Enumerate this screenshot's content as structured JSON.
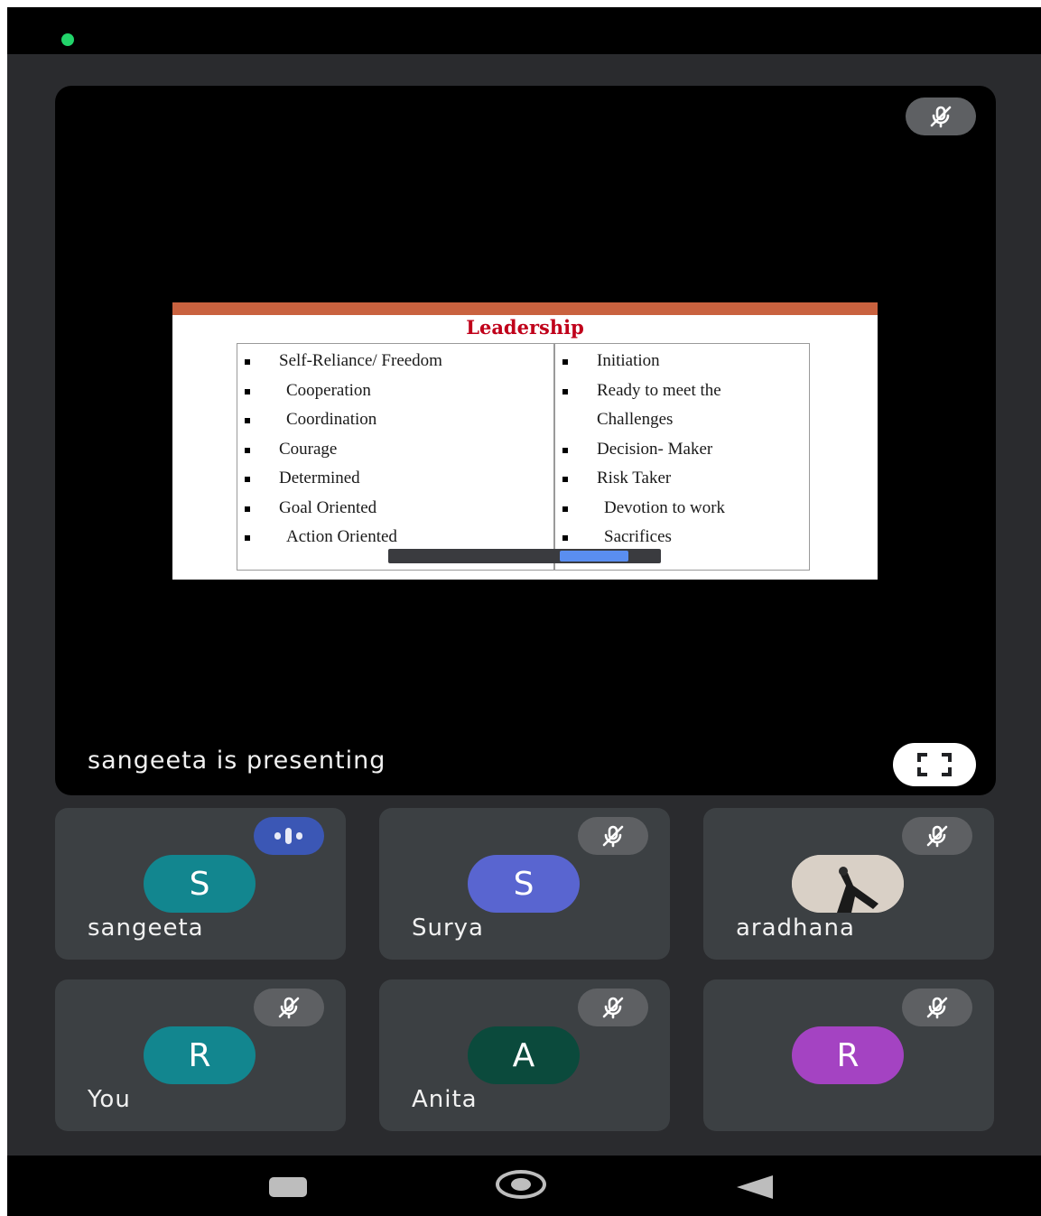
{
  "presentation": {
    "presenter_text": "sangeeta is presenting",
    "slide": {
      "title": "Leadership",
      "left_items": [
        "Self-Reliance/ Freedom",
        "Cooperation",
        "Coordination",
        "Courage",
        "Determined",
        "Goal Oriented",
        "Action Oriented"
      ],
      "right_items": [
        "Initiation",
        "Ready to meet the",
        "Challenges",
        "Decision- Maker",
        "Risk Taker",
        "Devotion to work",
        "Sacrifices"
      ]
    }
  },
  "participants": [
    {
      "name": "sangeeta",
      "initial": "S",
      "avatar_color": "#12868f",
      "status": "speaking"
    },
    {
      "name": "Surya",
      "initial": "S",
      "avatar_color": "#5965d0",
      "status": "muted"
    },
    {
      "name": "aradhana",
      "initial": "",
      "avatar_color": "#cfc6bd",
      "status": "muted",
      "avatar": "photo"
    },
    {
      "name": "You",
      "initial": "R",
      "avatar_color": "#12868f",
      "status": "muted"
    },
    {
      "name": "Anita",
      "initial": "A",
      "avatar_color": "#0b4a3c",
      "status": "muted"
    },
    {
      "name": "",
      "initial": "R",
      "avatar_color": "#a443c2",
      "status": "muted"
    }
  ],
  "icons": {
    "muted": "mic-off-icon",
    "speaking": "audio-level-icon",
    "fullscreen": "fullscreen-icon",
    "nav": [
      "recents-icon",
      "home-icon",
      "back-icon"
    ]
  },
  "colors": {
    "tile_bg": "#3c4043",
    "accent_green": "#22d46a",
    "slide_title": "#c0001a"
  }
}
